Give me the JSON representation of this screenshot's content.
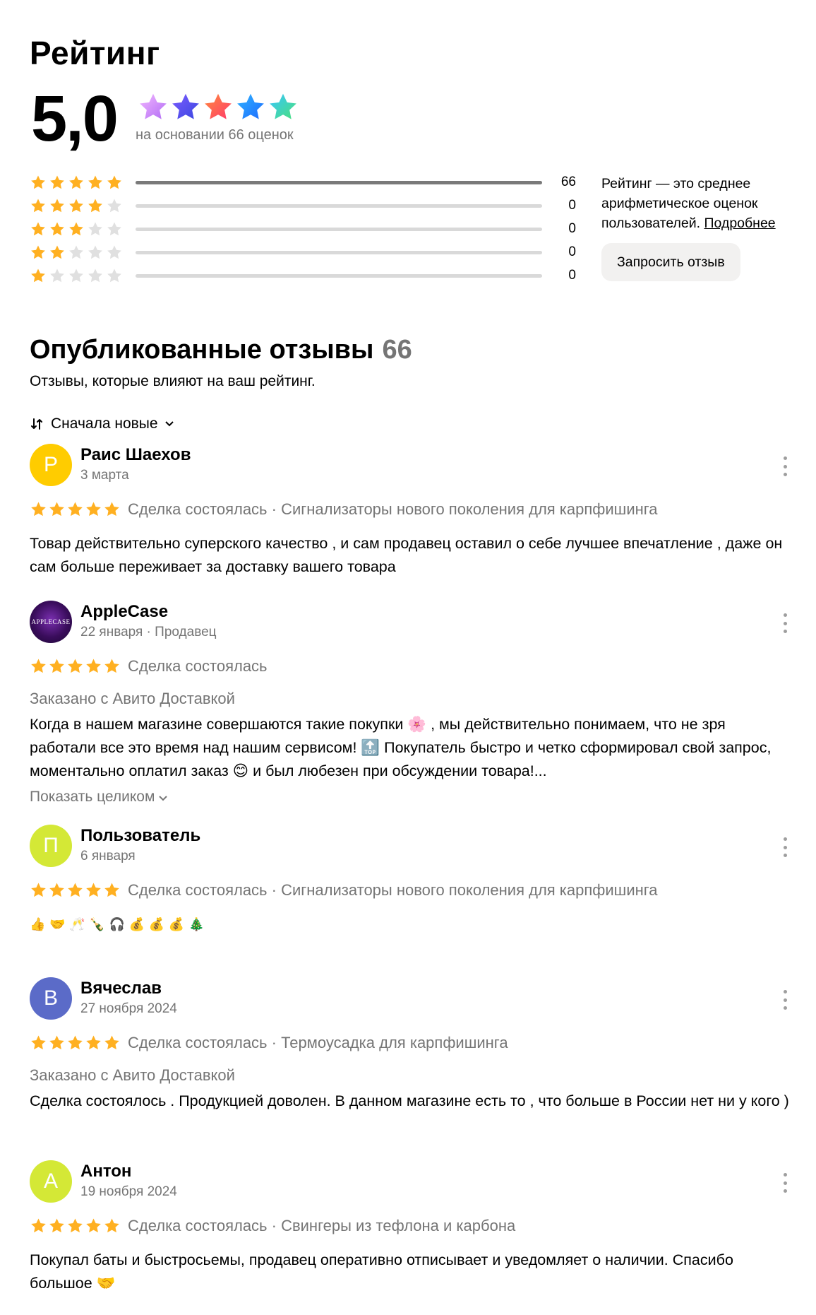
{
  "rating": {
    "title": "Рейтинг",
    "score": "5,0",
    "based_on": "на основании 66 оценок",
    "distribution": [
      {
        "stars": 5,
        "count": "66",
        "fraction": 1.0
      },
      {
        "stars": 4,
        "count": "0",
        "fraction": 0
      },
      {
        "stars": 3,
        "count": "0",
        "fraction": 0
      },
      {
        "stars": 2,
        "count": "0",
        "fraction": 0
      },
      {
        "stars": 1,
        "count": "0",
        "fraction": 0
      }
    ],
    "info_text": "Рейтинг — это среднее арифметическое оценок пользователей.",
    "info_link": "Подробнее",
    "request_button": "Запросить отзыв"
  },
  "published": {
    "title": "Опубликованные отзывы",
    "count": "66",
    "subtitle": "Отзывы, которые влияют на ваш рейтинг.",
    "sort_label": "Сначала новые"
  },
  "reviews": [
    {
      "initial": "Р",
      "avatar_color": "#ffcc00",
      "name": "Раис Шаехов",
      "date": "3 марта",
      "meta": "Сделка состоялась · Сигнализаторы нового поколения для карпфишинга",
      "delivery": "",
      "text": "Товар действительно суперского качество , и сам продавец оставил о себе лучшее впечатление , даже он сам больше переживает за доставку вашего товара",
      "more": ""
    },
    {
      "initial": "APPLECASE",
      "avatar_color": "#3a0d5c",
      "name": "AppleCase",
      "date": "22 января · Продавец",
      "meta": "Сделка состоялась",
      "delivery": "Заказано с Авито Доставкой",
      "text": "Когда в нашем магазине совершаются такие покупки 🌸 , мы действительно понимаем, что не зря работали все это время над нашим сервисом! 🔝 Покупатель быстро и четко сформировал свой запрос, моментально оплатил заказ 😊 и был любезен при обсуждении товара!...",
      "more": "Показать целиком"
    },
    {
      "initial": "П",
      "avatar_color": "#d4e836",
      "name": "Пользователь",
      "date": "6 января",
      "meta": "Сделка состоялась · Сигнализаторы нового поколения для карпфишинга",
      "delivery": "",
      "text": "👍 🤝 🥂 🍾 🎧 💰 💰 💰 🎄",
      "more": ""
    },
    {
      "initial": "В",
      "avatar_color": "#5b6bc8",
      "name": "Вячеслав",
      "date": "27 ноября 2024",
      "meta": "Сделка состоялась · Термоусадка для карпфишинга",
      "delivery": "Заказано с Авито Доставкой",
      "text": "Сделка состоялось . Продукцией доволен. В данном магазине есть то , что больше в России нет ни у кого )",
      "more": ""
    },
    {
      "initial": "А",
      "avatar_color": "#d4e836",
      "name": "Антон",
      "date": "19 ноября 2024",
      "meta": "Сделка состоялась · Свингеры из тефлона и карбона",
      "delivery": "",
      "text": "Покупал баты и быстросьемы, продавец оперативно отписывает и уведомляет о наличии. Спасибо большое 🤝",
      "more": ""
    }
  ],
  "colors": {
    "star_gold": "#ffb021",
    "star_empty": "#e0e0e0",
    "muted_text": "#757575"
  }
}
